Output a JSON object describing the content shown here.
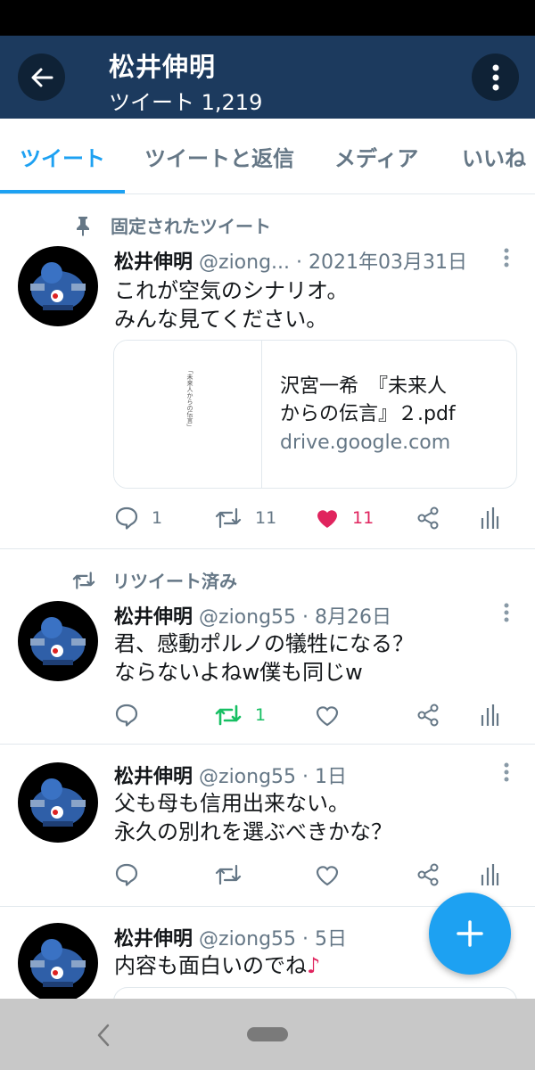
{
  "appbar": {
    "title": "松井伸明",
    "subtitle": "ツイート 1,219"
  },
  "tabs": [
    {
      "label": "ツイート",
      "active": true
    },
    {
      "label": "ツイートと返信",
      "active": false
    },
    {
      "label": "メディア",
      "active": false
    },
    {
      "label": "いいね",
      "active": false
    }
  ],
  "tweets": [
    {
      "context": "固定されたツイート",
      "context_icon": "pin-icon",
      "name": "松井伸明",
      "handle": "@ziong...",
      "sep": " · ",
      "time": "2021年03月31日",
      "lines": [
        "これが空気のシナリオ。",
        "みんな見てください。"
      ],
      "card": {
        "title_line1": "沢宮一希　『未来人",
        "title_line2": "からの伝言』２.pdf",
        "domain": "drive.google.com",
        "thumb_text": "「未来人からの伝言」"
      },
      "replies": "1",
      "retweets": "11",
      "likes": "11",
      "liked": true
    },
    {
      "context": "リツイート済み",
      "context_icon": "retweet-icon",
      "name": "松井伸明",
      "handle": "@ziong55",
      "sep": " · ",
      "time": "8月26日",
      "lines": [
        "君、感動ポルノの犠牲になる？",
        "ならないよねw僕も同じw"
      ],
      "replies": "",
      "retweets": "1",
      "likes": "",
      "retweeted": true
    },
    {
      "name": "松井伸明",
      "handle": "@ziong55",
      "sep": " · ",
      "time": "1日",
      "lines": [
        "父も母も信用出来ない。",
        "永久の別れを選ぶべきかな？"
      ],
      "replies": "",
      "retweets": "",
      "likes": ""
    },
    {
      "name": "松井伸明",
      "handle": "@ziong55",
      "sep": " · ",
      "time": "5日",
      "lines": [
        "内容も面白いのでね"
      ],
      "emoji": "♪"
    }
  ],
  "colors": {
    "appbar": "#1c3a5e",
    "accent": "#1da1f2",
    "like": "#e0245e",
    "retweet": "#17bf63",
    "muted": "#657786"
  },
  "icons": {
    "back": "arrow-left-icon",
    "menu": "vertical-dots-icon",
    "compose": "plus-icon",
    "reply": "comment-icon",
    "retweet": "retweet-icon",
    "like": "heart-icon",
    "share": "share-icon",
    "analytics": "bar-chart-icon"
  }
}
